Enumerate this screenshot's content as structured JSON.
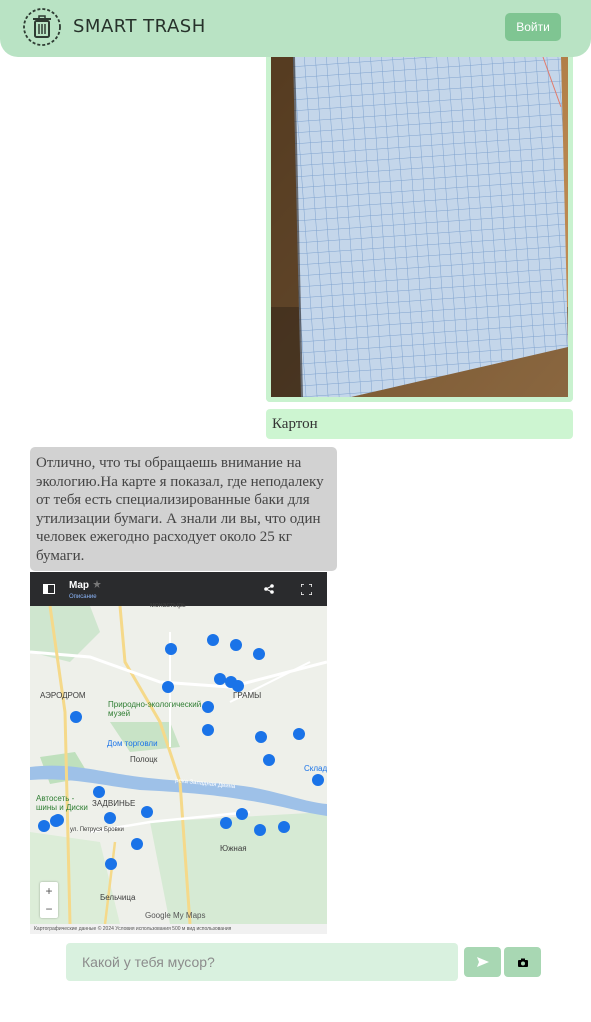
{
  "header": {
    "brand": "SMART TRASH",
    "login_label": "Войти",
    "logo_icon": "trash-can-icon",
    "background": "#b9e3c4"
  },
  "chat": {
    "user_label": "Картон",
    "bot_message": "Отлично, что ты обращаешь внимание на экологию.На карте я показал, где неподалеку от тебя есть специализированные баки для утилизации бумаги. А знали ли вы, что один человек ежегодно расходует около 25 кг бумаги."
  },
  "map": {
    "title": "Map",
    "description": "Описание",
    "labels": {
      "airport": "АЭРОДРОМ",
      "museum": "Природно-экологический музей",
      "trade_house": "Дом торговли",
      "polotsk": "Полоцк",
      "river": "река Западная Двина",
      "zadvinye": "ЗАДВИНЬЕ",
      "yuzhnaya": "Южная",
      "belchitsa": "Бельчица",
      "street": "ул. Петруся Бровки",
      "auto": "Автосеть - шины и Диски",
      "grams": "ГРАМЫ",
      "monastery": "монастырь",
      "sklad": "Склад"
    },
    "footer": "Картографические данные © 2024   Условия использования   500 м   вид использования",
    "brand": "Google My Maps",
    "zoom_in": "+",
    "zoom_out": "−"
  },
  "composer": {
    "placeholder": "Какой у тебя мусор?",
    "send_icon": "send-icon",
    "camera_icon": "camera-icon"
  }
}
